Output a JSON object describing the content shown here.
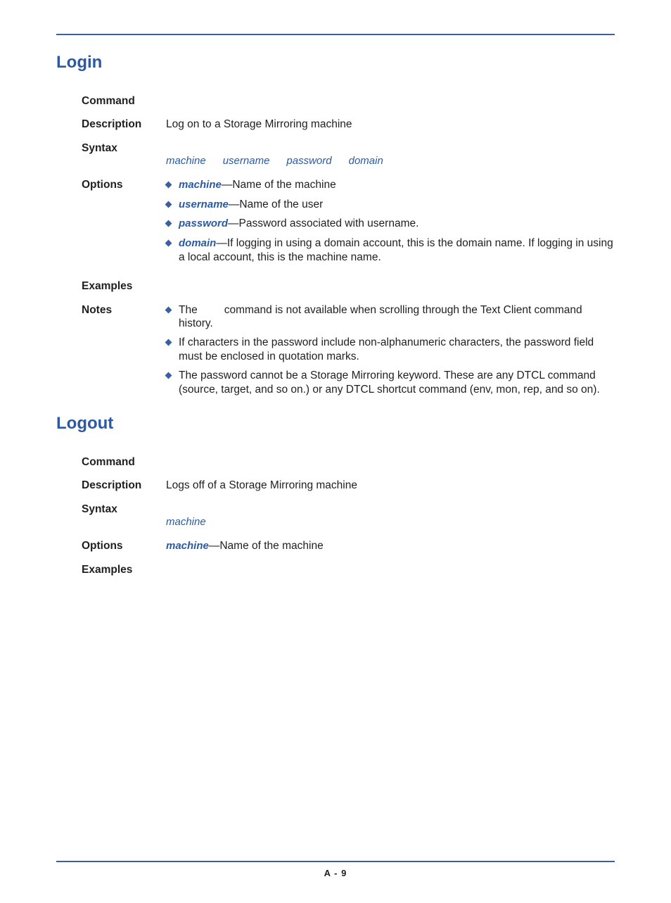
{
  "page_number": "A - 9",
  "login": {
    "title": "Login",
    "labels": {
      "command": "Command",
      "description": "Description",
      "syntax": "Syntax",
      "options": "Options",
      "examples": "Examples",
      "notes": "Notes"
    },
    "description": "Log on to a Storage Mirroring machine",
    "syntax_params": [
      "machine",
      "username",
      "password",
      "domain"
    ],
    "options": [
      {
        "key": "machine",
        "desc": "—Name of the machine"
      },
      {
        "key": "username",
        "desc": "—Name of the user"
      },
      {
        "key": "password",
        "desc": "—Password associated with username."
      },
      {
        "key": "domain",
        "desc": "—If logging in using a domain account, this is the domain name. If logging in using a local account, this is the machine name."
      }
    ],
    "notes": {
      "n1_a": "The",
      "n1_b": "command is not available when scrolling through the Text Client command history.",
      "n2": "If characters in the password include non-alphanumeric characters, the password field must be enclosed in quotation marks.",
      "n3": "The password cannot be a Storage Mirroring keyword. These are any DTCL command (source, target, and so on.) or any DTCL shortcut command (env, mon, rep, and so on)."
    }
  },
  "logout": {
    "title": "Logout",
    "labels": {
      "command": "Command",
      "description": "Description",
      "syntax": "Syntax",
      "options": "Options",
      "examples": "Examples"
    },
    "description": "Logs off of a Storage Mirroring machine",
    "syntax_params": [
      "machine"
    ],
    "option_key": "machine",
    "option_desc": "—Name of the machine"
  }
}
